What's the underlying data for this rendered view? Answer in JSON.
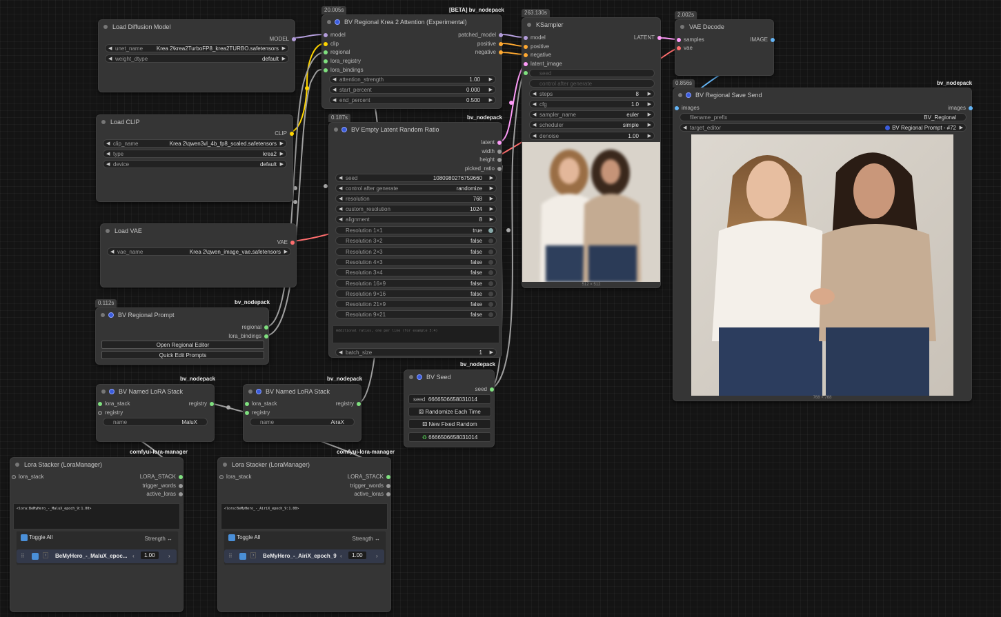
{
  "colors": {
    "canvas_bg": "#141414",
    "node_bg": "#353535",
    "model_wire": "#b39ddb",
    "clip_wire": "#ffd500",
    "vae_wire": "#ff6e6e",
    "conditioning_wire": "#ffa931",
    "latent_wire": "#ff9cf9",
    "image_wire": "#64b5f6",
    "generic_wire": "#aaaaaa",
    "green_slot": "#7fe07f"
  },
  "nodes": {
    "load_diffusion_model": {
      "title": "Load Diffusion Model",
      "output_model": "MODEL",
      "unet_name_label": "unet_name",
      "unet_name_value": "Krea 2\\krea2TurboFP8_krea2TURBO.safetensors",
      "weight_dtype_label": "weight_dtype",
      "weight_dtype_value": "default"
    },
    "load_clip": {
      "title": "Load CLIP",
      "output_clip": "CLIP",
      "clip_name_label": "clip_name",
      "clip_name_value": "Krea 2\\qwen3vl_4b_fp8_scaled.safetensors",
      "type_label": "type",
      "type_value": "krea2",
      "device_label": "device",
      "device_value": "default"
    },
    "load_vae": {
      "title": "Load VAE",
      "output_vae": "VAE",
      "vae_name_label": "vae_name",
      "vae_name_value": "Krea 2\\qwen_image_vae.safetensors"
    },
    "regional_prompt": {
      "time": "0.112s",
      "pack": "bv_nodepack",
      "title": "BV Regional Prompt",
      "out_regional": "regional",
      "out_lora_bindings": "lora_bindings",
      "btn_open": "Open Regional Editor",
      "btn_quick": "Quick Edit Prompts"
    },
    "regional_attention": {
      "time": "20.005s",
      "pack": "[BETA] bv_nodepack",
      "title": "BV Regional Krea 2 Attention (Experimental)",
      "in_model": "model",
      "in_clip": "clip",
      "in_regional": "regional",
      "in_lora_registry": "lora_registry",
      "in_lora_bindings": "lora_bindings",
      "out_patched_model": "patched_model",
      "out_positive": "positive",
      "out_negative": "negative",
      "attention_strength_label": "attention_strength",
      "attention_strength_value": "1.00",
      "start_percent_label": "start_percent",
      "start_percent_value": "0.000",
      "end_percent_label": "end_percent",
      "end_percent_value": "0.500"
    },
    "empty_latent": {
      "time": "0.187s",
      "pack": "bv_nodepack",
      "title": "BV Empty Latent Random Ratio",
      "out_latent": "latent",
      "out_width": "width",
      "out_height": "height",
      "out_picked_ratio": "picked_ratio",
      "seed_label": "seed",
      "seed_value": "1080980276759660",
      "cag_label": "control after generate",
      "cag_value": "randomize",
      "resolution_label": "resolution",
      "resolution_value": "768",
      "custom_resolution_label": "custom_resolution",
      "custom_resolution_value": "1024",
      "alignment_label": "alignment",
      "alignment_value": "8",
      "toggles": [
        {
          "label": "Resolution 1×1",
          "value": "true"
        },
        {
          "label": "Resolution 3×2",
          "value": "false"
        },
        {
          "label": "Resolution 2×3",
          "value": "false"
        },
        {
          "label": "Resolution 4×3",
          "value": "false"
        },
        {
          "label": "Resolution 3×4",
          "value": "false"
        },
        {
          "label": "Resolution 16×9",
          "value": "false"
        },
        {
          "label": "Resolution 9×16",
          "value": "false"
        },
        {
          "label": "Resolution 21×9",
          "value": "false"
        },
        {
          "label": "Resolution 9×21",
          "value": "false"
        }
      ],
      "extra_placeholder": "Additional ratios, one per line (for example 5:4)",
      "batch_size_label": "batch_size",
      "batch_size_value": "1"
    },
    "ksampler": {
      "time": "263.130s",
      "title": "KSampler",
      "in_model": "model",
      "in_positive": "positive",
      "in_negative": "negative",
      "in_latent_image": "latent_image",
      "out_latent": "LATENT",
      "seed_label": "seed",
      "cag_label": "control after generate",
      "steps_label": "steps",
      "steps_value": "8",
      "cfg_label": "cfg",
      "cfg_value": "1.0",
      "sampler_label": "sampler_name",
      "sampler_value": "euler",
      "scheduler_label": "scheduler",
      "scheduler_value": "simple",
      "denoise_label": "denoise",
      "denoise_value": "1.00",
      "preview_size": "512 × 512"
    },
    "vae_decode": {
      "time": "2.002s",
      "title": "VAE Decode",
      "in_samples": "samples",
      "in_vae": "vae",
      "out_image": "IMAGE"
    },
    "save_send": {
      "time": "0.856s",
      "pack": "bv_nodepack",
      "title": "BV Regional Save Send",
      "in_images": "images",
      "out_images": "images",
      "filename_prefix_label": "filename_prefix",
      "filename_prefix_value": "BV_Regional",
      "target_editor_label": "target_editor",
      "target_editor_value": "BV Regional Prompt - #72",
      "image_size": "768 × 768"
    },
    "seed": {
      "pack": "bv_nodepack",
      "title": "BV Seed",
      "out_seed": "seed",
      "seed_label": "seed",
      "seed_value": "6666506658031014",
      "btn_randomize": "Randomize Each Time",
      "btn_new_fixed": "New Fixed Random",
      "btn_last": "6666506658031014"
    },
    "lora_stack_1": {
      "pack": "bv_nodepack",
      "title": "BV Named LoRA Stack",
      "in_lora_stack": "lora_stack",
      "in_registry": "registry",
      "out_registry": "registry",
      "name_label": "name",
      "name_value": "MaluX"
    },
    "lora_stack_2": {
      "pack": "bv_nodepack",
      "title": "BV Named LoRA Stack",
      "in_lora_stack": "lora_stack",
      "in_registry": "registry",
      "out_registry": "registry",
      "name_label": "name",
      "name_value": "AiraX"
    },
    "lora_stacker_1": {
      "pack": "comfyui-lora-manager",
      "title": "Lora Stacker (LoraManager)",
      "in_lora_stack": "lora_stack",
      "out_lora_stack": "LORA_STACK",
      "out_trigger_words": "trigger_words",
      "out_active_loras": "active_loras",
      "text": "<lora:BeMyHero_-_MaluX_epoch_9:1.00>",
      "toggle_all": "Toggle All",
      "strength": "Strength ↔",
      "lora_name": "BeMyHero_-_MaluX_epoc...",
      "lora_strength": "1.00"
    },
    "lora_stacker_2": {
      "pack": "comfyui-lora-manager",
      "title": "Lora Stacker (LoraManager)",
      "in_lora_stack": "lora_stack",
      "out_lora_stack": "LORA_STACK",
      "out_trigger_words": "trigger_words",
      "out_active_loras": "active_loras",
      "text": "<lora:BeMyHero_-_AiriX_epoch_9:1.00>",
      "toggle_all": "Toggle All",
      "strength": "Strength ↔",
      "lora_name": "BeMyHero_-_AiriX_epoch_9",
      "lora_strength": "1.00"
    }
  }
}
